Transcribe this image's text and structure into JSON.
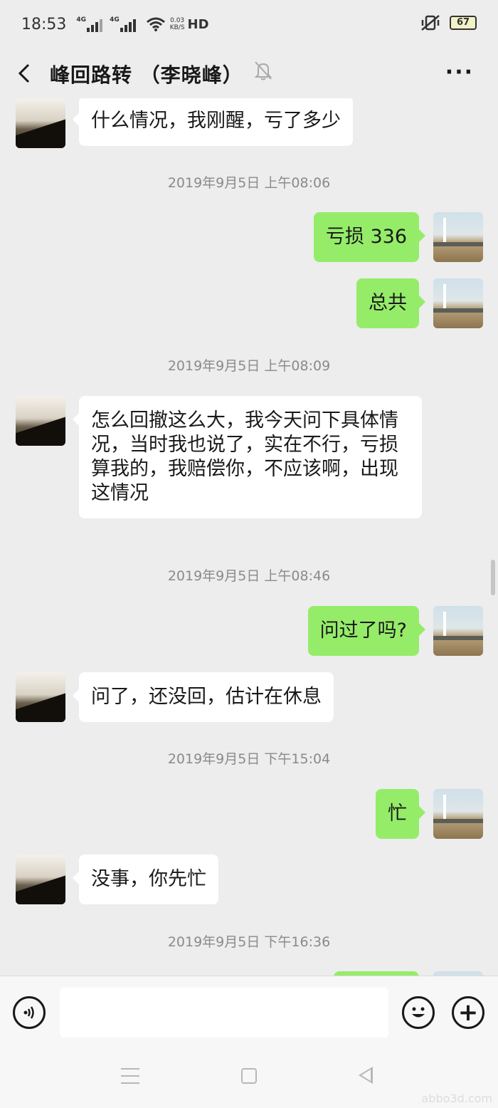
{
  "status_bar": {
    "time": "18:53",
    "signal1_tag": "4G",
    "signal2_tag": "4G",
    "net_speed_value": "0.03",
    "net_speed_unit": "KB/S",
    "hd": "HD",
    "battery": "67"
  },
  "header": {
    "back_icon": "chevron-left-icon",
    "title": "峰回路转 （李晓峰）",
    "mute_icon": "bell-off-icon",
    "more_label": "···"
  },
  "messages": [
    {
      "side": "left",
      "text": "什么情况，我刚醒，亏了多少"
    },
    {
      "timestamp": "2019年9月5日 上午08:06"
    },
    {
      "side": "right",
      "text": "亏损 336"
    },
    {
      "side": "right",
      "text": "总共"
    },
    {
      "timestamp": "2019年9月5日 上午08:09"
    },
    {
      "side": "left",
      "text": "怎么回撤这么大，我今天问下具体情况，当时我也说了，实在不行，亏损算我的，我赔偿你，不应该啊，出现这情况"
    },
    {
      "timestamp": "2019年9月5日 上午08:46"
    },
    {
      "side": "right",
      "text": "问过了吗?"
    },
    {
      "side": "left",
      "text": "问了，还没回，估计在休息"
    },
    {
      "timestamp": "2019年9月5日 下午15:04"
    },
    {
      "side": "right",
      "text": "忙"
    },
    {
      "side": "left",
      "text": "没事，你先忙"
    },
    {
      "timestamp": "2019年9月5日 下午16:36"
    }
  ],
  "input_bar": {
    "voice_icon": "voice-icon",
    "input_value": "",
    "emoji_icon": "emoji-icon",
    "plus_icon": "plus-icon",
    "plus_label": "+"
  },
  "colors": {
    "sent_bubble": "#95ec69",
    "received_bubble": "#ffffff",
    "background": "#ededed"
  },
  "watermark": "abbo3d.com"
}
